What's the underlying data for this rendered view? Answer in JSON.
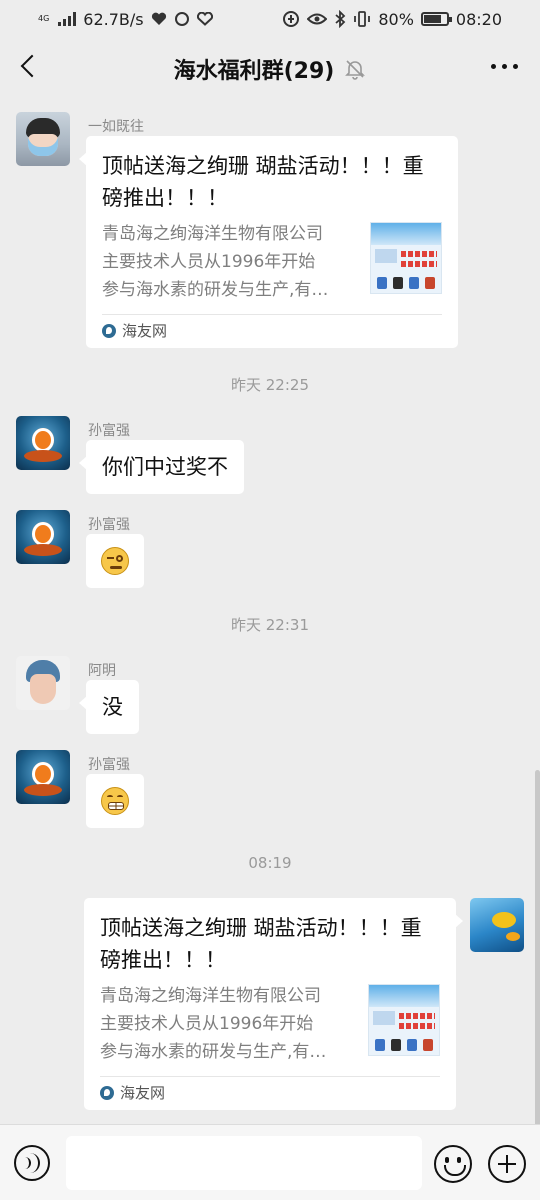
{
  "status_bar": {
    "network_type": "4G",
    "speed": "62.7B/s",
    "battery": "80%",
    "battery_level": 0.8,
    "time": "08:20"
  },
  "header": {
    "title": "海水福利群(29)"
  },
  "messages": [
    {
      "sender": "一如既往",
      "card": {
        "title": "顶帖送海之绚珊 瑚盐活动！！！重磅推出！！！",
        "desc": [
          "青岛海之绚海洋生物有限公司",
          "主要技术人员从1996年开始",
          "参与海水素的研发与生产,有…"
        ],
        "source": "海友网"
      }
    },
    {
      "sender": "孙富强",
      "text": "你们中过奖不"
    },
    {
      "sender": "孙富强",
      "emoji": "awkward-emoji"
    },
    {
      "sender": "阿明",
      "text": "没"
    },
    {
      "sender": "孙富强",
      "emoji": "grin-emoji"
    },
    {
      "self": true,
      "card": {
        "title": "顶帖送海之绚珊 瑚盐活动！！！重磅推出！！！",
        "desc": [
          "青岛海之绚海洋生物有限公司",
          "主要技术人员从1996年开始",
          "参与海水素的研发与生产,有…"
        ],
        "source": "海友网"
      }
    }
  ],
  "timestamps": [
    "昨天 22:25",
    "昨天 22:31",
    "08:19"
  ],
  "input": {
    "value": ""
  }
}
